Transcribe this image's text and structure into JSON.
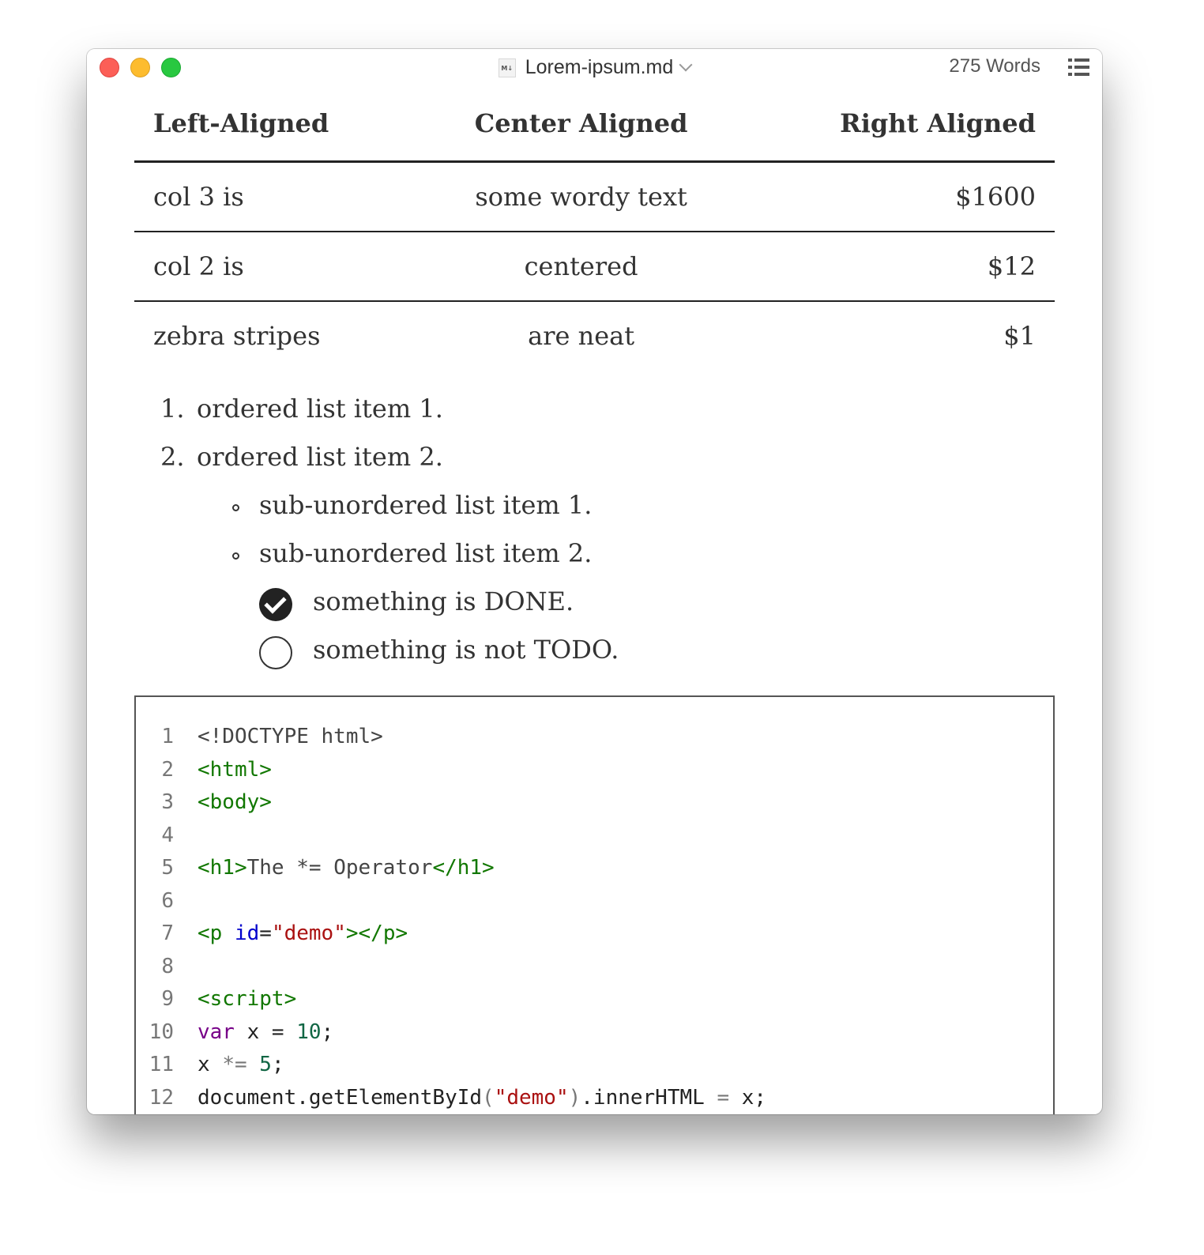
{
  "window": {
    "title": "Lorem-ipsum.md",
    "file_badge": "M↓",
    "word_count": "275 Words"
  },
  "table": {
    "headers": [
      "Left-Aligned",
      "Center Aligned",
      "Right Aligned"
    ],
    "rows": [
      [
        "col 3 is",
        "some wordy text",
        "$1600"
      ],
      [
        "col 2 is",
        "centered",
        "$12"
      ],
      [
        "zebra stripes",
        "are neat",
        "$1"
      ]
    ]
  },
  "ordered_list": [
    {
      "marker": "1.",
      "text": "ordered list item 1."
    },
    {
      "marker": "2.",
      "text": "ordered list item 2."
    }
  ],
  "sub_list": [
    {
      "text": "sub-unordered list item 1."
    },
    {
      "text": "sub-unordered list item 2."
    }
  ],
  "tasks": [
    {
      "text": "something is DONE.",
      "checked": true
    },
    {
      "text": "something is not TODO.",
      "checked": false
    }
  ],
  "code": {
    "line_numbers": [
      "1",
      "2",
      "3",
      "4",
      "5",
      "6",
      "7",
      "8",
      "9",
      "10",
      "11",
      "12"
    ],
    "l1": "<!DOCTYPE html>",
    "l2": "<html>",
    "l3": "<body>",
    "l5_open": "<h1>",
    "l5_text": "The *= Operator",
    "l5_close": "</h1>",
    "l7_open": "<p ",
    "l7_attr": "id",
    "l7_eq": "=",
    "l7_str": "\"demo\"",
    "l7_close": "></p>",
    "l9": "<script>",
    "l10_kw": "var",
    "l10_mid": " x = ",
    "l10_num": "10",
    "l10_end": ";",
    "l11_a": "x ",
    "l11_op": "*=",
    "l11_sp": " ",
    "l11_num": "5",
    "l11_end": ";",
    "l12_a": "document.getElementById",
    "l12_p1": "(",
    "l12_str": "\"demo\"",
    "l12_p2": ")",
    "l12_b": ".innerHTML ",
    "l12_eq": "=",
    "l12_c": " x;"
  }
}
